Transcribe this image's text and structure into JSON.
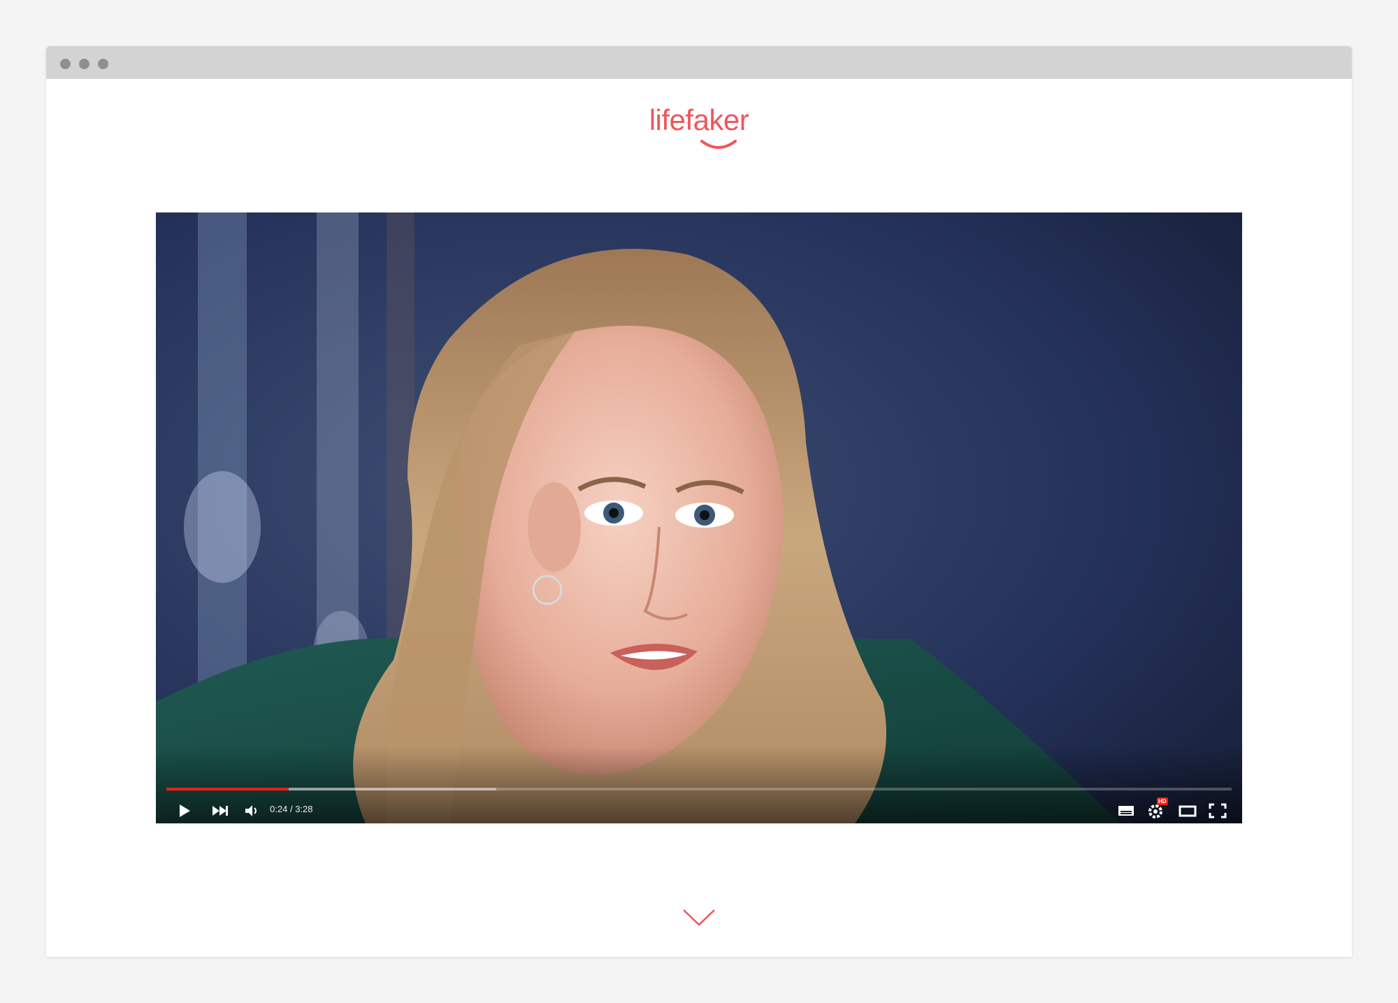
{
  "browser": {
    "chrome_color": "#d3d3d3",
    "traffic_dot_color": "#8f8f8f"
  },
  "header": {
    "logo_text": "lifefaker",
    "brand_color": "#f0555a"
  },
  "video_player": {
    "current_time": "0:24",
    "separator": "/",
    "duration": "3:28",
    "progress_played_fraction": 0.115,
    "progress_buffered_fraction": 0.31,
    "progress_color": "#e62117",
    "hd_badge": "HD",
    "icons": [
      "play-icon",
      "next-icon",
      "volume-icon",
      "subtitles-icon",
      "settings-icon",
      "theater-mode-icon",
      "fullscreen-icon"
    ]
  },
  "scroll_hint": {
    "icon": "chevron-down-icon"
  }
}
